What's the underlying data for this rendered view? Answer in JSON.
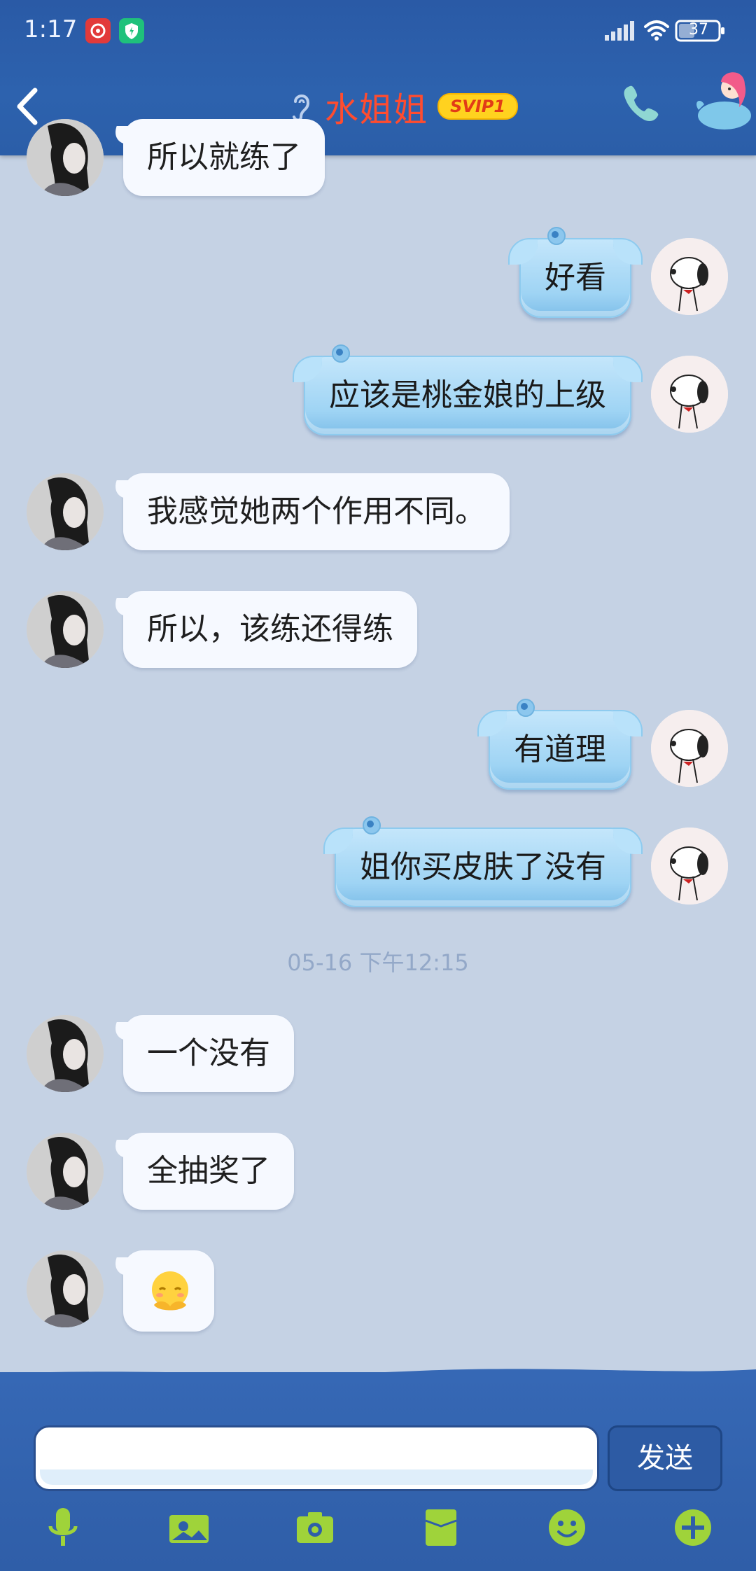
{
  "status_bar": {
    "time": "1:17",
    "battery": "37"
  },
  "header": {
    "title": "水姐姐",
    "badge": "SVIP1"
  },
  "messages": {
    "m0": "所以就练了",
    "m1": "好看",
    "m2": "应该是桃金娘的上级",
    "m3": "我感觉她两个作用不同。",
    "m4": "所以，该练还得练",
    "m5": "有道理",
    "m6": "姐你买皮肤了没有",
    "m7": "一个没有",
    "m8": "全抽奖了"
  },
  "timestamp": "05-16 下午12:15",
  "input": {
    "value": "",
    "send_label": "发送"
  },
  "toolbar": [
    "mic-icon",
    "image-icon",
    "camera-icon",
    "red-packet-icon",
    "emoji-icon",
    "plus-icon"
  ],
  "colors": {
    "header_bg": "#2d62ae",
    "title": "#ff4c2f",
    "chat_bg": "#c5d2e4",
    "toolbar_icon": "#9fd33a"
  }
}
